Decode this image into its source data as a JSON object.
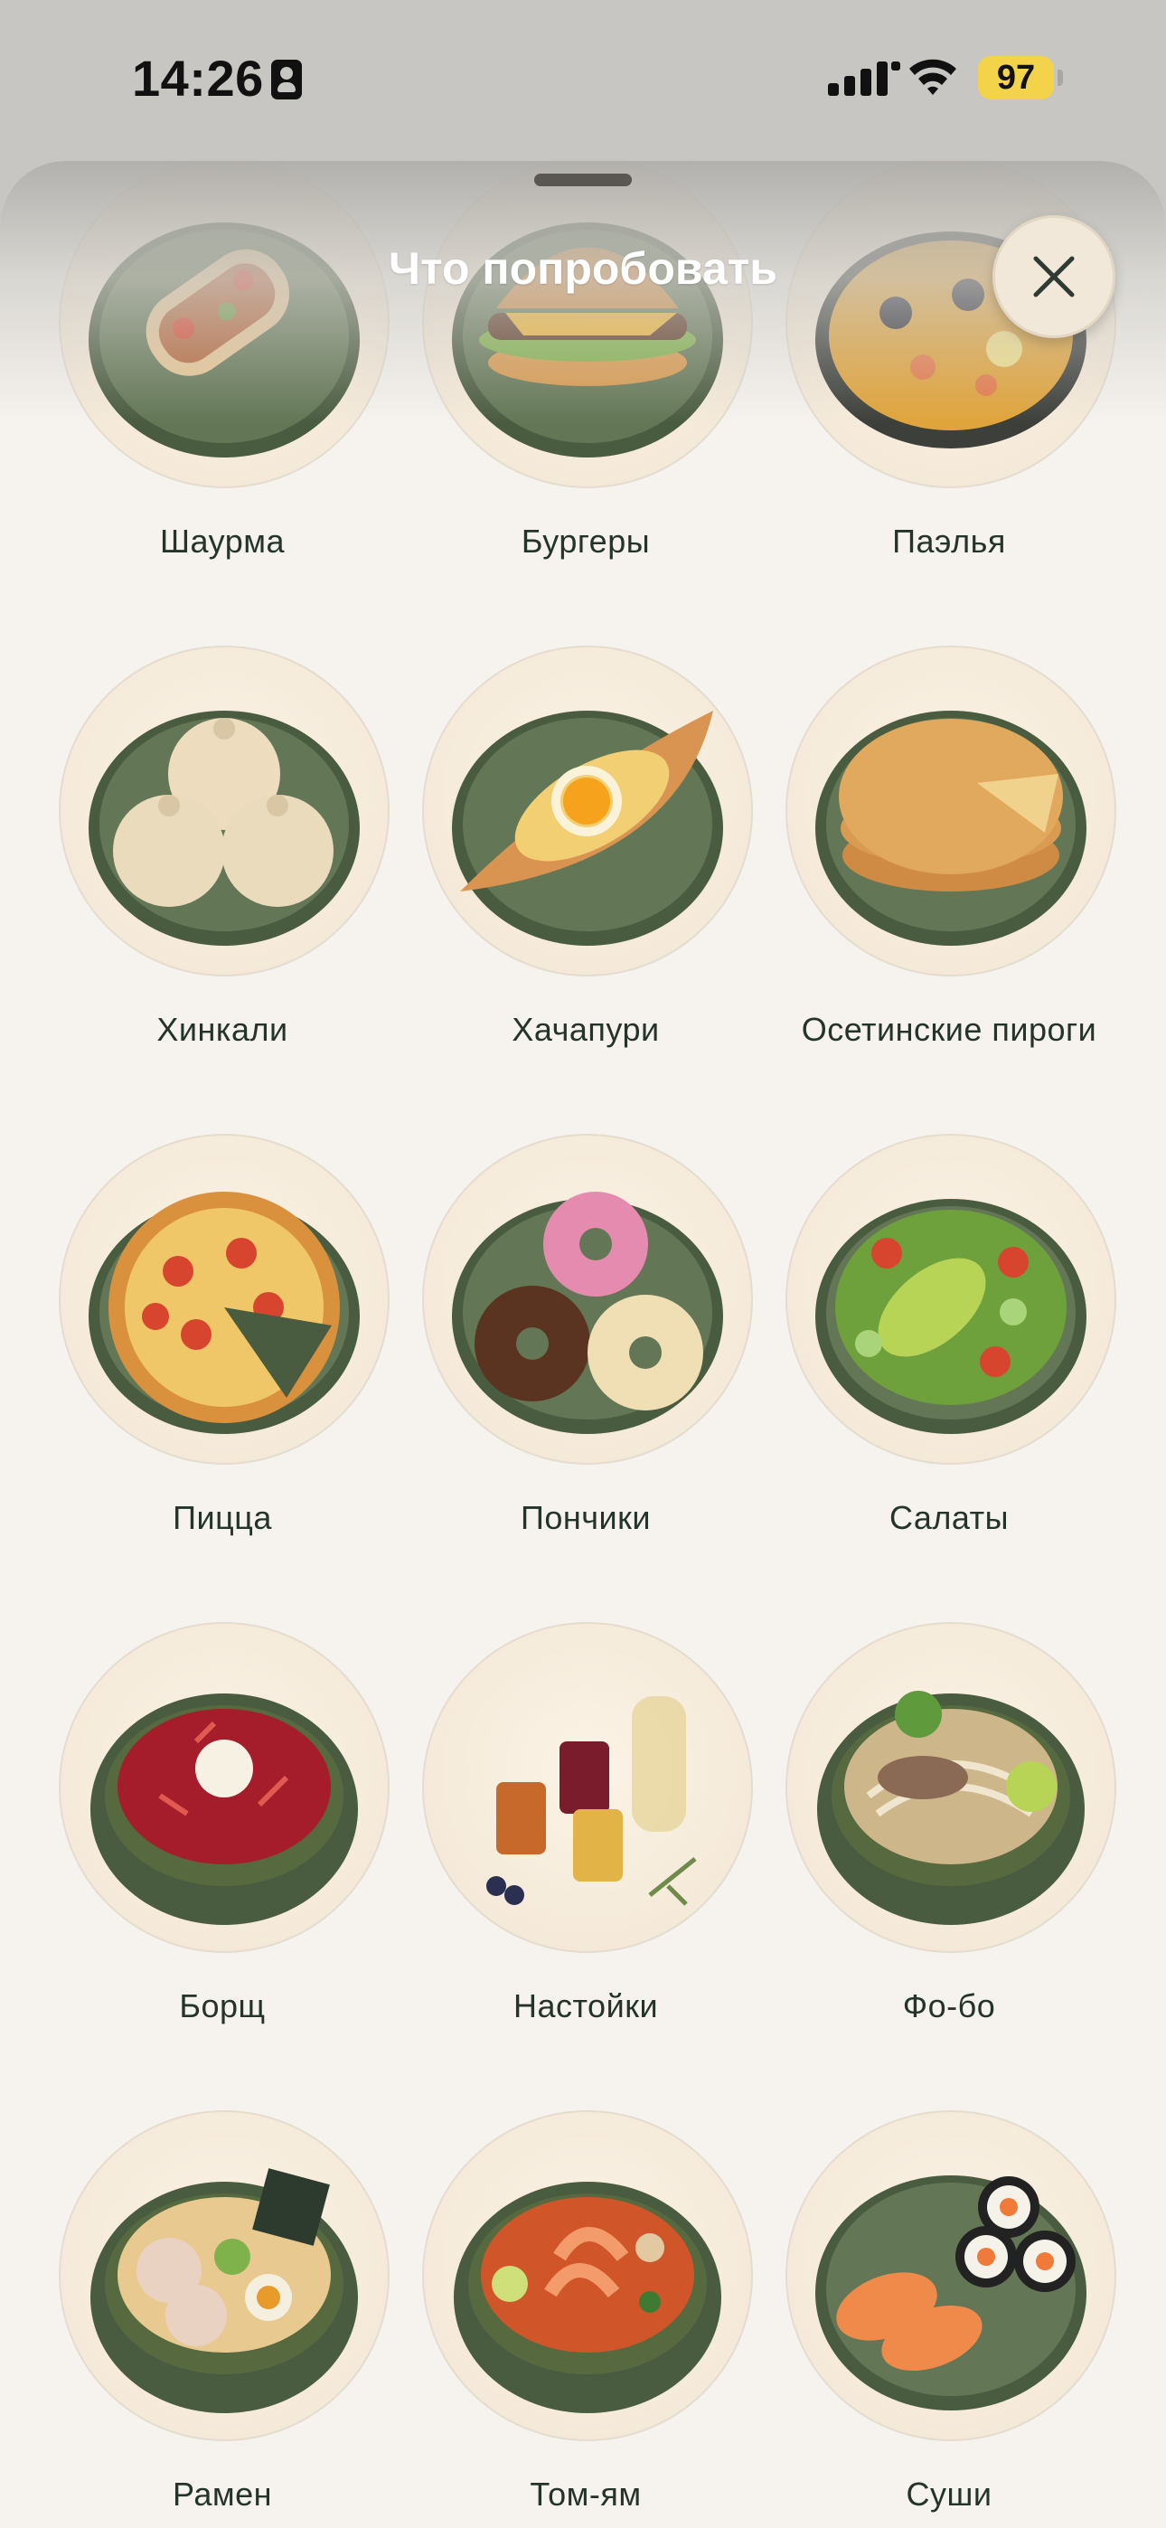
{
  "status_bar": {
    "time": "14:26",
    "battery": "97"
  },
  "sheet": {
    "title": "Что попробовать"
  },
  "colors": {
    "plate": "#5f7352",
    "plate_rim": "#4a5c40",
    "text": "#24342b",
    "sheet_bg": "#f6f3ee",
    "battery": "#f3d34a"
  },
  "items": [
    {
      "label": "Шаурма",
      "icon": "shawarma-icon"
    },
    {
      "label": "Бургеры",
      "icon": "burger-icon"
    },
    {
      "label": "Паэлья",
      "icon": "paella-icon"
    },
    {
      "label": "Хинкали",
      "icon": "khinkali-icon"
    },
    {
      "label": "Хачапури",
      "icon": "khachapuri-icon"
    },
    {
      "label": "Осетинские пироги",
      "icon": "ossetian-pie-icon"
    },
    {
      "label": "Пицца",
      "icon": "pizza-icon"
    },
    {
      "label": "Пончики",
      "icon": "donuts-icon"
    },
    {
      "label": "Салаты",
      "icon": "salad-icon"
    },
    {
      "label": "Борщ",
      "icon": "borscht-icon"
    },
    {
      "label": "Настойки",
      "icon": "liqueur-icon"
    },
    {
      "label": "Фо-бо",
      "icon": "pho-icon"
    },
    {
      "label": "Рамен",
      "icon": "ramen-icon"
    },
    {
      "label": "Том-ям",
      "icon": "tom-yum-icon"
    },
    {
      "label": "Суши",
      "icon": "sushi-icon"
    }
  ]
}
